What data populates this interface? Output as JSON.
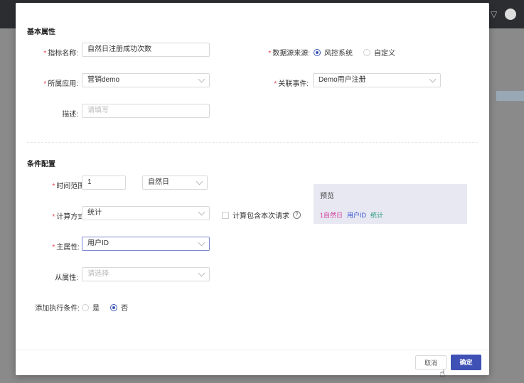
{
  "modal": {
    "basic_section": "基本属性",
    "metric_name": {
      "label": "指标名称:",
      "value": "自然日注册成功次数"
    },
    "data_source": {
      "label": "数据源来源:",
      "options": [
        "风控系统",
        "自定义"
      ],
      "selected": "风控系统"
    },
    "app": {
      "label": "所属应用:",
      "value": "营销demo"
    },
    "event": {
      "label": "关联事件:",
      "value": "Demo用户注册"
    },
    "description": {
      "label": "描述:",
      "placeholder": "请填写"
    },
    "condition_section": "条件配置",
    "time_range": {
      "label": "时间范围:",
      "value": "1",
      "unit": "自然日"
    },
    "calc_method": {
      "label": "计算方式:",
      "value": "统计"
    },
    "include_current": {
      "label": "计算包含本次请求",
      "checked": false,
      "help": "?"
    },
    "main_attr": {
      "label": "主属性:",
      "value": "用户ID"
    },
    "sub_attr": {
      "label": "从属性:",
      "placeholder": "请选择"
    },
    "add_condition": {
      "label": "添加执行条件:",
      "options": [
        "是",
        "否"
      ],
      "selected": "否"
    },
    "preview": {
      "title": "预览",
      "tokens": [
        {
          "text": "1自然日",
          "color": "#d0389b"
        },
        {
          "text": "用户ID",
          "color": "#3a55d0"
        },
        {
          "text": "统计",
          "color": "#2a9a7a"
        }
      ]
    },
    "cancel": "取消",
    "ok": "确定"
  },
  "colors": {
    "primary": "#3f51b5",
    "required": "#e5484d"
  }
}
